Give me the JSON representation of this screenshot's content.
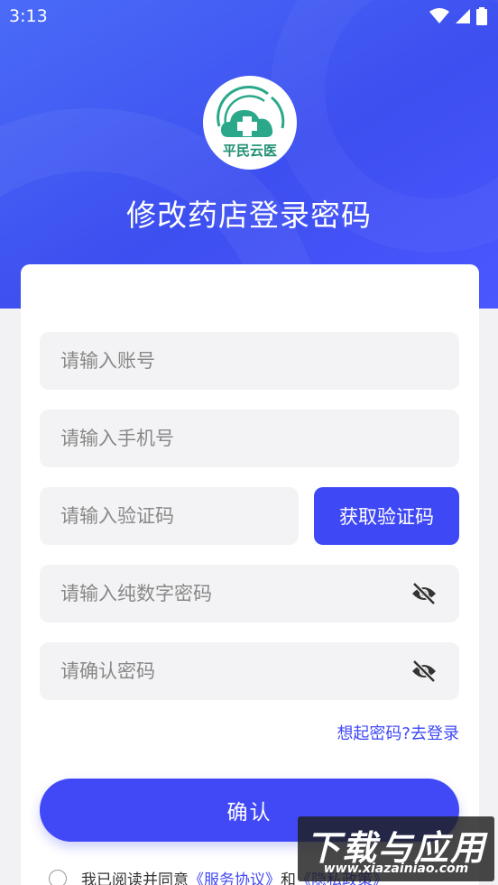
{
  "status_bar": {
    "time": "3:13"
  },
  "logo": {
    "text": "平民云医"
  },
  "page": {
    "title": "修改药店登录密码"
  },
  "form": {
    "account_placeholder": "请输入账号",
    "phone_placeholder": "请输入手机号",
    "code_placeholder": "请输入验证码",
    "get_code_label": "获取验证码",
    "password_placeholder": "请输入纯数字密码",
    "confirm_password_placeholder": "请确认密码",
    "login_link": "想起密码?去登录",
    "confirm_label": "确认"
  },
  "agreement": {
    "prefix": "我已阅读并同意",
    "service_link": "《服务协议》",
    "and": "和",
    "privacy_link": "《隐私政策》"
  },
  "watermark": {
    "title": "下载与应用",
    "url": "www.xiazainiao.com"
  },
  "colors": {
    "primary": "#3f48f5",
    "hero": "#4a57ff",
    "logo_green": "#2aa889"
  }
}
